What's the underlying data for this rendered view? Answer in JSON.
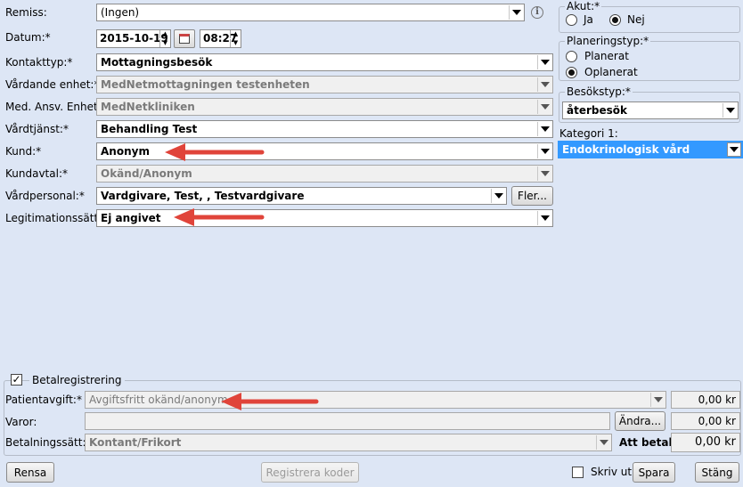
{
  "form": {
    "remiss": {
      "label": "Remiss:",
      "value": "(Ingen)"
    },
    "datum": {
      "label": "Datum:*",
      "date": "2015-10-19",
      "time": "08:27"
    },
    "kontakttyp": {
      "label": "Kontakttyp:*",
      "value": "Mottagningsbesök"
    },
    "vardande_enhet": {
      "label": "Vårdande enhet:*",
      "value": "MedNetmottagningen testenheten"
    },
    "med_ansv_enhet": {
      "label": "Med. Ansv. Enhet:*",
      "value": "MedNetkliniken"
    },
    "vardtjanst": {
      "label": "Vårdtjänst:*",
      "value": "Behandling Test"
    },
    "kund": {
      "label": "Kund:*",
      "value": "Anonym"
    },
    "kundavtal": {
      "label": "Kundavtal:*",
      "value": "Okänd/Anonym"
    },
    "vardpersonal": {
      "label": "Vårdpersonal:*",
      "value": "Vardgivare, Test, , Testvardgivare",
      "more_button": "Fler..."
    },
    "legitimationssatt": {
      "label": "Legitimationssätt:*",
      "value": "Ej angivet"
    }
  },
  "right_panel": {
    "akut": {
      "legend": "Akut:*",
      "options": [
        "Ja",
        "Nej"
      ],
      "selected": "Nej"
    },
    "planeringstyp": {
      "legend": "Planeringstyp:*",
      "options": [
        "Planerat",
        "Oplanerat"
      ],
      "selected": "Oplanerat"
    },
    "besokstyp": {
      "legend": "Besökstyp:*",
      "value": "återbesök"
    },
    "kategori": {
      "label": "Kategori 1:",
      "value": "Endokrinologisk vård"
    }
  },
  "payment": {
    "legend": "Betalregistrering",
    "checked": true,
    "patientavgift": {
      "label": "Patientavgift:*",
      "value": "Avgiftsfritt okänd/anonym",
      "amount": "0,00 kr"
    },
    "varor": {
      "label": "Varor:",
      "button": "Ändra...",
      "amount": "0,00 kr"
    },
    "betalningssatt": {
      "label": "Betalningssätt:*",
      "value": "Kontant/Frikort",
      "total_label": "Att betala:",
      "total": "0,00 kr"
    }
  },
  "footer": {
    "rensa": "Rensa",
    "registrera": "Registrera koder",
    "skriv_ut": "Skriv ut",
    "spara": "Spara",
    "stang": "Stäng"
  },
  "colors": {
    "background": "#dde6f5",
    "selection": "#3399ff",
    "annotation_arrow": "#e0443a"
  }
}
